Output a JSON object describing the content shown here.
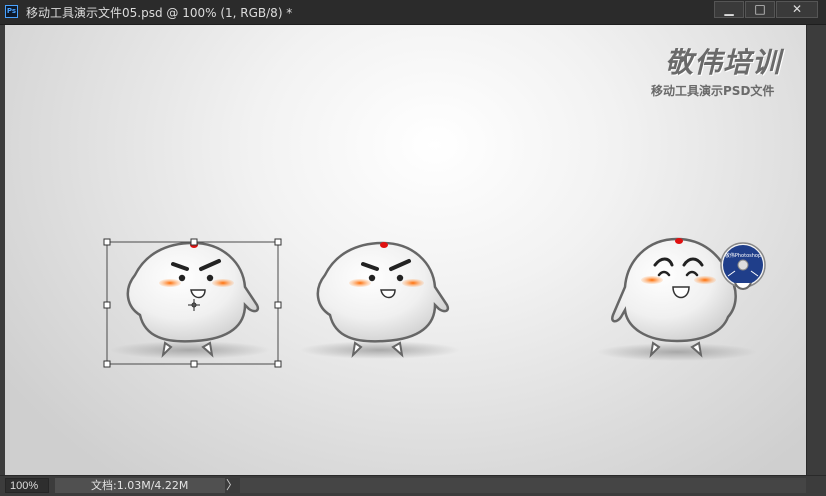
{
  "window": {
    "title": "移动工具演示文件05.psd @ 100% (1, RGB/8) *",
    "app_icon": "photoshop-icon",
    "buttons": {
      "minimize": "▁",
      "maximize": "□",
      "close": "✕"
    }
  },
  "canvas": {
    "watermark_title": "敬伟培训",
    "watermark_subtitle": "移动工具演示PSD文件",
    "cd_label": "敬伟Photoshop"
  },
  "status": {
    "zoom": "100%",
    "doc_info": "文档:1.03M/4.22M",
    "menu_arrow": "〉"
  },
  "colors": {
    "selection": "#4a4a4a",
    "cheek": "#ff7a1a",
    "topknot": "#e01010"
  }
}
